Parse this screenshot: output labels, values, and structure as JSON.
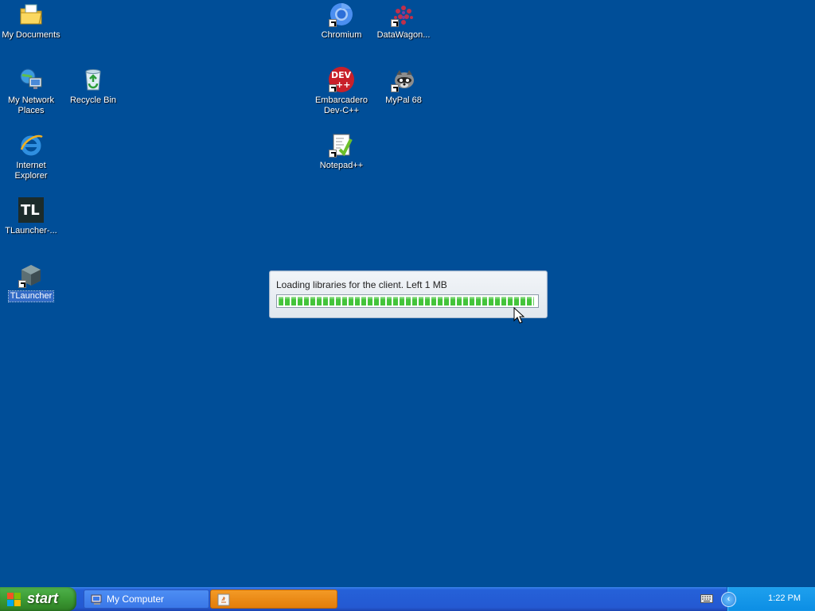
{
  "desktop": {
    "background_color": "#004e98",
    "icons": [
      {
        "label": "My Documents",
        "icon": "folder-documents-icon"
      },
      {
        "label": "My Network Places",
        "icon": "network-places-icon"
      },
      {
        "label": "Recycle Bin",
        "icon": "recycle-bin-icon"
      },
      {
        "label": "Internet Explorer",
        "icon": "internet-explorer-icon"
      },
      {
        "label": "TLauncher-...",
        "icon": "tlauncher-logo-icon"
      },
      {
        "label": "TLauncher",
        "icon": "tlauncher-block-icon"
      },
      {
        "label": "Chromium",
        "icon": "chromium-icon"
      },
      {
        "label": "DataWagon...",
        "icon": "datawagon-icon"
      },
      {
        "label": "Embarcadero Dev-C++",
        "icon": "devcpp-icon"
      },
      {
        "label": "MyPal 68",
        "icon": "mypal-raccoon-icon"
      },
      {
        "label": "Notepad++",
        "icon": "notepad-plus-plus-icon"
      }
    ],
    "tl_text": "TL",
    "dev_text": "DEV",
    "dev_plus": "++"
  },
  "loading_dialog": {
    "message": "Loading libraries for the client. Left 1 MB",
    "progress_fraction": 0.99
  },
  "taskbar": {
    "start_label": "start",
    "tasks": [
      {
        "label": "My Computer",
        "icon": "my-computer-icon"
      },
      {
        "label": "",
        "icon": "java-icon"
      }
    ],
    "tray": {
      "clock": "1:22 PM",
      "chevron": "‹"
    }
  }
}
